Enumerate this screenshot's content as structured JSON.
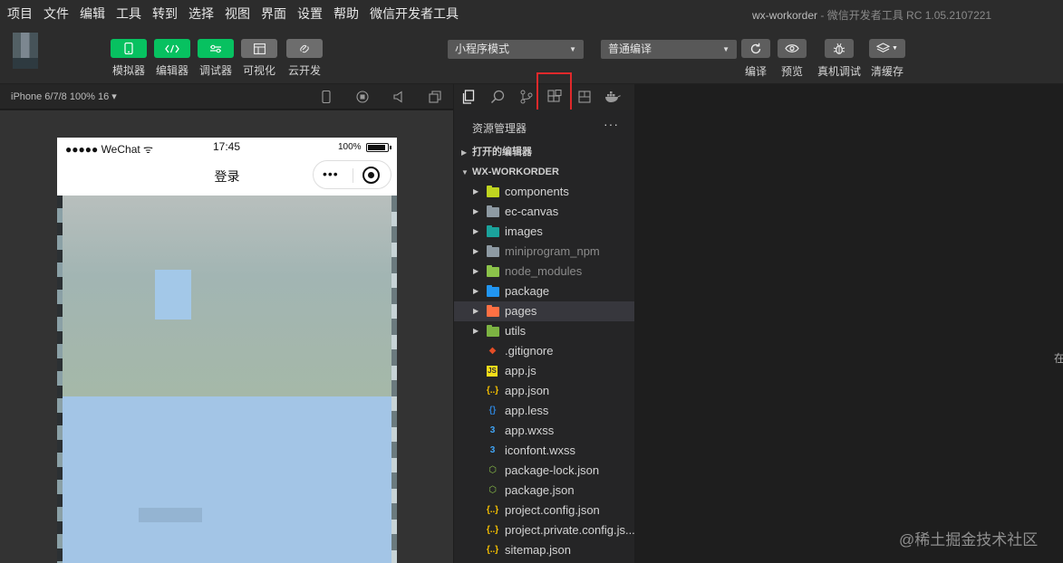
{
  "menu": [
    "项目",
    "文件",
    "编辑",
    "工具",
    "转到",
    "选择",
    "视图",
    "界面",
    "设置",
    "帮助",
    "微信开发者工具"
  ],
  "title": {
    "project": "wx-workorder",
    "separator": " - ",
    "app": "微信开发者工具 RC 1.05.2107221"
  },
  "toolbar": {
    "tools": [
      {
        "label": "模拟器",
        "icon": "phone-icon"
      },
      {
        "label": "编辑器",
        "icon": "code-icon"
      },
      {
        "label": "调试器",
        "icon": "sliders-icon"
      },
      {
        "label": "可视化",
        "icon": "layout-icon"
      },
      {
        "label": "云开发",
        "icon": "cloud-link-icon"
      }
    ],
    "mode_select": "小程序模式",
    "compile_select": "普通编译",
    "actions": [
      {
        "label": "编译",
        "icon": "refresh-icon"
      },
      {
        "label": "预览",
        "icon": "eye-icon"
      },
      {
        "label": "真机调试",
        "icon": "bug-icon"
      },
      {
        "label": "清缓存",
        "icon": "layers-icon"
      }
    ]
  },
  "simulator": {
    "device": "iPhone 6/7/8 100% 16 ▾",
    "status": {
      "carrier": "●●●●● WeChat",
      "time": "17:45",
      "battery": "100%"
    },
    "nav_title": "登录",
    "capsule_dots": "•••"
  },
  "explorer": {
    "header": "资源管理器",
    "more": "···",
    "open_editors": "打开的编辑器",
    "project": "WX-WORKORDER",
    "items": [
      {
        "name": "components",
        "type": "folder",
        "color": "#c0d520"
      },
      {
        "name": "ec-canvas",
        "type": "folder",
        "color": "#8e9aa3"
      },
      {
        "name": "images",
        "type": "folder",
        "color": "#1ba39c"
      },
      {
        "name": "miniprogram_npm",
        "type": "folder",
        "color": "#8e9aa3",
        "dim": true
      },
      {
        "name": "node_modules",
        "type": "folder",
        "color": "#8bc34a",
        "dim": true
      },
      {
        "name": "package",
        "type": "folder",
        "color": "#2196f3"
      },
      {
        "name": "pages",
        "type": "folder",
        "color": "#ff7043",
        "selected": true
      },
      {
        "name": "utils",
        "type": "folder",
        "color": "#7cb342"
      },
      {
        "name": ".gitignore",
        "type": "file",
        "glyph": "◆",
        "color": "#e44d26"
      },
      {
        "name": "app.js",
        "type": "file",
        "glyph": "JS",
        "color": "#f5de19"
      },
      {
        "name": "app.json",
        "type": "file",
        "glyph": "{..}",
        "color": "#f5c000"
      },
      {
        "name": "app.less",
        "type": "file",
        "glyph": "{}",
        "color": "#2d7fd1"
      },
      {
        "name": "app.wxss",
        "type": "file",
        "glyph": "3",
        "color": "#42a5f5"
      },
      {
        "name": "iconfont.wxss",
        "type": "file",
        "glyph": "3",
        "color": "#42a5f5"
      },
      {
        "name": "package-lock.json",
        "type": "file",
        "glyph": "⬡",
        "color": "#8bc34a"
      },
      {
        "name": "package.json",
        "type": "file",
        "glyph": "⬡",
        "color": "#8bc34a"
      },
      {
        "name": "project.config.json",
        "type": "file",
        "glyph": "{..}",
        "color": "#f5c000"
      },
      {
        "name": "project.private.config.js...",
        "type": "file",
        "glyph": "{..}",
        "color": "#f5c000"
      },
      {
        "name": "sitemap.json",
        "type": "file",
        "glyph": "{..}",
        "color": "#f5c000"
      }
    ]
  },
  "edge_text": "在",
  "watermark": "@稀土掘金技术社区",
  "colors": {
    "accent_green": "#07c160",
    "highlight_red": "#e0292b"
  }
}
